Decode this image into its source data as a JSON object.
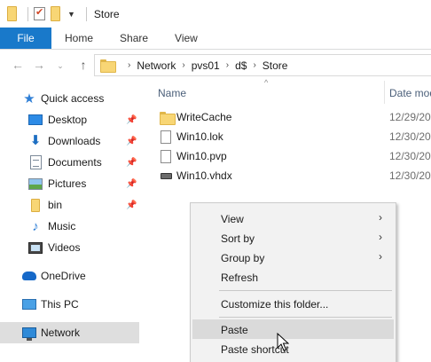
{
  "window": {
    "title": "Store"
  },
  "ribbon": {
    "tabs": [
      "File",
      "Home",
      "Share",
      "View"
    ]
  },
  "address": {
    "breadcrumb": [
      "Network",
      "pvs01",
      "d$",
      "Store"
    ]
  },
  "navpane": {
    "quick_access": "Quick access",
    "pinned": [
      {
        "label": "Desktop",
        "icon": "desktop-icon",
        "pinned": true
      },
      {
        "label": "Downloads",
        "icon": "downloads-icon",
        "pinned": true
      },
      {
        "label": "Documents",
        "icon": "documents-icon",
        "pinned": true
      },
      {
        "label": "Pictures",
        "icon": "pictures-icon",
        "pinned": true
      },
      {
        "label": "bin",
        "icon": "folder-icon",
        "pinned": true
      },
      {
        "label": "Music",
        "icon": "music-icon",
        "pinned": false
      },
      {
        "label": "Videos",
        "icon": "videos-icon",
        "pinned": false
      }
    ],
    "onedrive": "OneDrive",
    "this_pc": "This PC",
    "network": "Network"
  },
  "columns": {
    "name": "Name",
    "date": "Date mod"
  },
  "files": [
    {
      "name": "WriteCache",
      "date": "12/29/20",
      "type": "folder"
    },
    {
      "name": "Win10.lok",
      "date": "12/30/20",
      "type": "file"
    },
    {
      "name": "Win10.pvp",
      "date": "12/30/20",
      "type": "file"
    },
    {
      "name": "Win10.vhdx",
      "date": "12/30/20",
      "type": "vhdx"
    }
  ],
  "context_menu": {
    "view": "View",
    "sort_by": "Sort by",
    "group_by": "Group by",
    "refresh": "Refresh",
    "customize": "Customize this folder...",
    "paste": "Paste",
    "paste_shortcut": "Paste shortcut"
  },
  "colors": {
    "file_tab": "#1979ca",
    "selected_nav": "#dedede",
    "menu_bg": "#f2f2f2"
  }
}
